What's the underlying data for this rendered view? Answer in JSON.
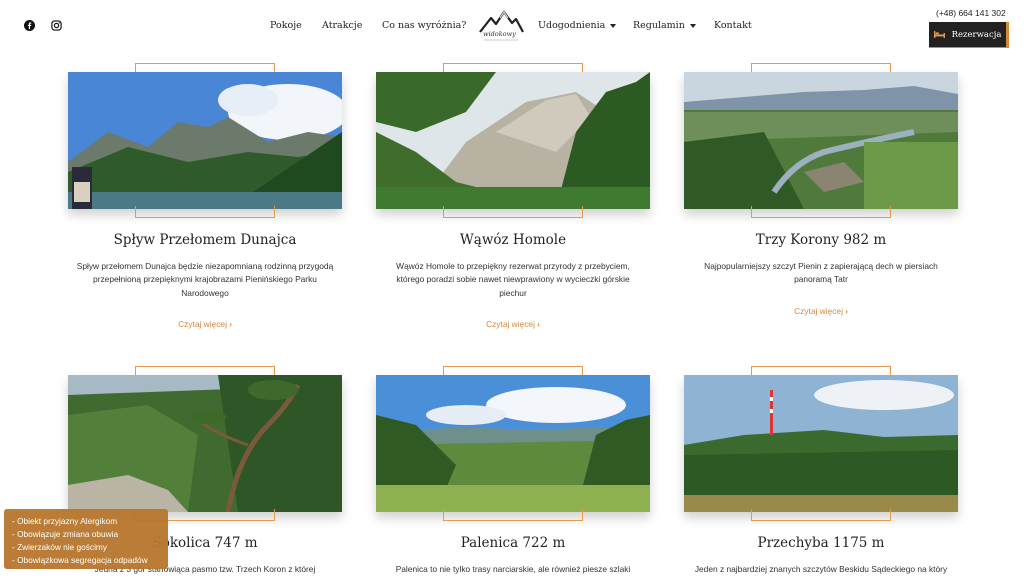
{
  "header": {
    "social": [
      "facebook-icon",
      "instagram-icon"
    ],
    "nav": {
      "pokoje": "Pokoje",
      "atrakcje": "Atrakcje",
      "wyroznia": "Co nas wyróżnia?",
      "udogodnienia": "Udogodnienia",
      "regulamin": "Regulamin",
      "kontakt": "Kontakt"
    },
    "logo_text": "widokowy",
    "phone": "(+48) 664 141 302",
    "reserve_label": "Rezerwacja"
  },
  "cards": [
    {
      "title": "Spływ Przełomem Dunajca",
      "desc": [
        "Spływ przełomem Dunajca będzie niezapomnianą rodzinną przygodą",
        "przepełnioną przepięknymi krajobrazami Pienińskiego Parku",
        "Narodowego"
      ],
      "more": "Czytaj więcej"
    },
    {
      "title": "Wąwóz Homole",
      "desc": [
        "Wąwóz Homole to przepiękny rezerwat przyrody z przebyciem,",
        "którego poradzi sobie nawet niewprawiony w wycieczki górskie",
        "piechur"
      ],
      "more": "Czytaj więcej"
    },
    {
      "title": "Trzy Korony 982 m",
      "desc": [
        "Najpopularniejszy szczyt Pienin z zapierającą dech w piersiach",
        "panoramą Tatr"
      ],
      "more": "Czytaj więcej"
    },
    {
      "title": "Sokolica 747 m",
      "desc": [
        "Jedna z 3 gór stanowiąca pasmo tzw. Trzech Koron z której"
      ]
    },
    {
      "title": "Palenica 722 m",
      "desc": [
        "Palenica to nie tylko trasy narciarskie, ale również piesze szlaki"
      ]
    },
    {
      "title": "Przechyba 1175 m",
      "desc": [
        "Jeden z najbardziej znanych szczytów Beskidu Sądeckiego na który"
      ]
    }
  ],
  "info_box": [
    "-  Obiekt przyjazny Alergikom",
    "-  Obowiązuje zmiana obuwia",
    "-  Zwierzaków nie gościmy",
    "-  Obowiązkowa segregacja odpadów"
  ],
  "colors": {
    "accent": "#d48a3e",
    "dark": "#222222",
    "info_bg": "#b8772f"
  }
}
